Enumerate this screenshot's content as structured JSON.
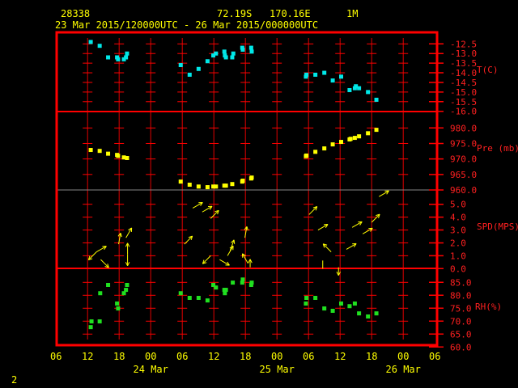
{
  "header": {
    "station": "28338",
    "latitude": "72.19S",
    "longitude": "170.16E",
    "height": "1M",
    "period": "23 Mar 2015/120000UTC - 26 Mar 2015/000000UTC"
  },
  "page_number": "2",
  "colors": {
    "frame": "#ff0000",
    "temperature": "#00e8e8",
    "pressure": "#ffff00",
    "wind": "#ffff00",
    "humidity": "#20e020",
    "text": "#ffff00"
  },
  "x_axis": {
    "tick_labels": [
      "06",
      "12",
      "18",
      "00",
      "06",
      "12",
      "18",
      "00",
      "06",
      "12",
      "18",
      "00",
      "06"
    ],
    "date_labels": [
      "24 Mar",
      "25 Mar",
      "26 Mar"
    ],
    "range": [
      "2015-03-23 06:00",
      "2015-03-26 06:00"
    ]
  },
  "chart_data": [
    {
      "type": "scatter",
      "ylabel": "T(C)",
      "ylim": [
        -16.0,
        -12.5
      ],
      "tick_labels": [
        "-12.5",
        "-13.0",
        "-13.5",
        "-14.0",
        "-14.5",
        "-15.0",
        "-15.5",
        "-16.0"
      ],
      "points": [
        [
          "2015-03-23 12:36",
          -12.4
        ],
        [
          "2015-03-23 14:18",
          -12.6
        ],
        [
          "2015-03-23 15:54",
          -13.2
        ],
        [
          "2015-03-23 17:36",
          -13.2
        ],
        [
          "2015-03-23 17:48",
          -13.3
        ],
        [
          "2015-03-23 18:54",
          -13.3
        ],
        [
          "2015-03-23 19:18",
          -13.2
        ],
        [
          "2015-03-23 19:30",
          -13.0
        ],
        [
          "2015-03-24 05:42",
          -13.6
        ],
        [
          "2015-03-24 07:24",
          -14.1
        ],
        [
          "2015-03-24 09:06",
          -13.8
        ],
        [
          "2015-03-24 10:48",
          -13.4
        ],
        [
          "2015-03-24 11:54",
          -13.1
        ],
        [
          "2015-03-24 12:24",
          -13.0
        ],
        [
          "2015-03-24 14:00",
          -12.9
        ],
        [
          "2015-03-24 14:06",
          -13.1
        ],
        [
          "2015-03-24 14:18",
          -13.2
        ],
        [
          "2015-03-24 15:30",
          -13.2
        ],
        [
          "2015-03-24 15:42",
          -13.0
        ],
        [
          "2015-03-24 17:24",
          -12.7
        ],
        [
          "2015-03-24 17:30",
          -12.8
        ],
        [
          "2015-03-24 19:06",
          -12.7
        ],
        [
          "2015-03-24 19:12",
          -12.9
        ],
        [
          "2015-03-25 05:30",
          -14.2
        ],
        [
          "2015-03-25 05:36",
          -14.1
        ],
        [
          "2015-03-25 07:18",
          -14.1
        ],
        [
          "2015-03-25 09:00",
          -14.0
        ],
        [
          "2015-03-25 10:36",
          -14.4
        ],
        [
          "2015-03-25 12:12",
          -14.2
        ],
        [
          "2015-03-25 13:48",
          -14.9
        ],
        [
          "2015-03-25 14:48",
          -14.8
        ],
        [
          "2015-03-25 15:00",
          -14.7
        ],
        [
          "2015-03-25 15:36",
          -14.8
        ],
        [
          "2015-03-25 17:18",
          -15.0
        ],
        [
          "2015-03-25 18:54",
          -15.4
        ]
      ]
    },
    {
      "type": "scatter",
      "ylabel": "Pre (mb)",
      "ylim": [
        960.0,
        980.0
      ],
      "tick_labels": [
        "980.0",
        "975.0",
        "970.0",
        "965.0",
        "960.0"
      ],
      "points": [
        [
          "2015-03-23 12:36",
          972.9
        ],
        [
          "2015-03-23 14:18",
          972.6
        ],
        [
          "2015-03-23 15:54",
          971.7
        ],
        [
          "2015-03-23 17:36",
          971.3
        ],
        [
          "2015-03-23 17:48",
          971.0
        ],
        [
          "2015-03-23 18:54",
          970.5
        ],
        [
          "2015-03-23 19:30",
          970.3
        ],
        [
          "2015-03-24 05:42",
          962.7
        ],
        [
          "2015-03-24 07:24",
          961.7
        ],
        [
          "2015-03-24 09:06",
          961.1
        ],
        [
          "2015-03-24 10:48",
          960.9
        ],
        [
          "2015-03-24 11:54",
          961.1
        ],
        [
          "2015-03-24 12:24",
          961.1
        ],
        [
          "2015-03-24 14:00",
          961.4
        ],
        [
          "2015-03-24 14:18",
          961.4
        ],
        [
          "2015-03-24 15:30",
          961.9
        ],
        [
          "2015-03-24 17:24",
          962.7
        ],
        [
          "2015-03-24 17:30",
          963.0
        ],
        [
          "2015-03-24 19:06",
          963.7
        ],
        [
          "2015-03-24 19:12",
          964.0
        ],
        [
          "2015-03-25 05:30",
          970.9
        ],
        [
          "2015-03-25 05:36",
          971.1
        ],
        [
          "2015-03-25 07:18",
          972.3
        ],
        [
          "2015-03-25 09:00",
          973.4
        ],
        [
          "2015-03-25 10:36",
          974.7
        ],
        [
          "2015-03-25 12:12",
          975.5
        ],
        [
          "2015-03-25 13:48",
          976.3
        ],
        [
          "2015-03-25 14:00",
          976.5
        ],
        [
          "2015-03-25 14:48",
          976.8
        ],
        [
          "2015-03-25 15:36",
          977.3
        ],
        [
          "2015-03-25 17:18",
          978.3
        ],
        [
          "2015-03-25 18:54",
          979.4
        ]
      ]
    },
    {
      "type": "vector",
      "ylabel": "SPD(MPS)",
      "ylim": [
        0.0,
        5.0
      ],
      "tick_labels": [
        "5.0",
        "4.0",
        "3.0",
        "2.0",
        "1.0",
        "0.0"
      ],
      "points": [
        [
          "2015-03-23 13:42",
          1.3,
          225
        ],
        [
          "2015-03-23 13:42",
          1.3,
          60
        ],
        [
          "2015-03-23 14:30",
          0.7,
          135
        ],
        [
          "2015-03-23 17:54",
          1.9,
          10
        ],
        [
          "2015-03-23 19:18",
          2.4,
          30
        ],
        [
          "2015-03-23 19:36",
          1.1,
          180
        ],
        [
          "2015-03-23 19:36",
          1.1,
          0
        ],
        [
          "2015-03-24 06:24",
          1.9,
          45
        ],
        [
          "2015-03-24 08:00",
          4.7,
          60
        ],
        [
          "2015-03-24 09:48",
          4.4,
          60
        ],
        [
          "2015-03-24 11:24",
          3.9,
          45
        ],
        [
          "2015-03-24 11:24",
          1.0,
          225
        ],
        [
          "2015-03-24 13:06",
          0.7,
          120
        ],
        [
          "2015-03-24 14:36",
          1.0,
          30
        ],
        [
          "2015-03-24 15:06",
          1.4,
          20
        ],
        [
          "2015-03-24 17:54",
          2.4,
          10
        ],
        [
          "2015-03-24 18:30",
          0.4,
          330
        ],
        [
          "2015-03-24 18:54",
          0.1,
          0
        ],
        [
          "2015-03-25 06:06",
          4.2,
          45
        ],
        [
          "2015-03-25 07:48",
          3.0,
          60
        ],
        [
          "2015-03-25 08:42",
          0.0,
          0
        ],
        [
          "2015-03-25 10:18",
          1.3,
          315
        ],
        [
          "2015-03-25 11:42",
          0.1,
          180
        ],
        [
          "2015-03-25 13:12",
          1.5,
          60
        ],
        [
          "2015-03-25 14:18",
          3.2,
          60
        ],
        [
          "2015-03-25 16:18",
          2.7,
          60
        ],
        [
          "2015-03-25 18:00",
          3.6,
          45
        ],
        [
          "2015-03-25 19:24",
          5.6,
          60
        ]
      ]
    },
    {
      "type": "scatter",
      "ylabel": "RH(%)",
      "ylim": [
        60.0,
        85.0
      ],
      "tick_labels": [
        "85.0",
        "80.0",
        "75.0",
        "70.0",
        "65.0",
        "60.0"
      ],
      "points": [
        [
          "2015-03-23 12:36",
          67.7
        ],
        [
          "2015-03-23 12:45",
          69.9
        ],
        [
          "2015-03-23 14:18",
          69.9
        ],
        [
          "2015-03-23 14:24",
          80.8
        ],
        [
          "2015-03-23 15:54",
          84.0
        ],
        [
          "2015-03-23 17:36",
          76.8
        ],
        [
          "2015-03-23 17:48",
          74.9
        ],
        [
          "2015-03-23 18:54",
          80.8
        ],
        [
          "2015-03-23 19:18",
          82.1
        ],
        [
          "2015-03-23 19:30",
          84.0
        ],
        [
          "2015-03-24 05:42",
          80.8
        ],
        [
          "2015-03-24 07:24",
          79.0
        ],
        [
          "2015-03-24 09:06",
          79.0
        ],
        [
          "2015-03-24 10:48",
          78.0
        ],
        [
          "2015-03-24 11:54",
          84.0
        ],
        [
          "2015-03-24 12:24",
          83.0
        ],
        [
          "2015-03-24 14:00",
          82.1
        ],
        [
          "2015-03-24 14:06",
          80.8
        ],
        [
          "2015-03-24 14:18",
          82.1
        ],
        [
          "2015-03-24 15:36",
          84.9
        ],
        [
          "2015-03-24 17:24",
          84.9
        ],
        [
          "2015-03-24 17:30",
          86.1
        ],
        [
          "2015-03-24 19:06",
          84.0
        ],
        [
          "2015-03-24 19:12",
          84.9
        ],
        [
          "2015-03-25 05:30",
          76.8
        ],
        [
          "2015-03-25 05:36",
          79.0
        ],
        [
          "2015-03-25 07:18",
          79.0
        ],
        [
          "2015-03-25 09:00",
          74.9
        ],
        [
          "2015-03-25 10:36",
          74.0
        ],
        [
          "2015-03-25 12:12",
          76.8
        ],
        [
          "2015-03-25 13:48",
          75.8
        ],
        [
          "2015-03-25 14:48",
          76.8
        ],
        [
          "2015-03-25 15:36",
          73.0
        ],
        [
          "2015-03-25 17:18",
          71.8
        ],
        [
          "2015-03-25 18:54",
          73.0
        ]
      ]
    }
  ]
}
